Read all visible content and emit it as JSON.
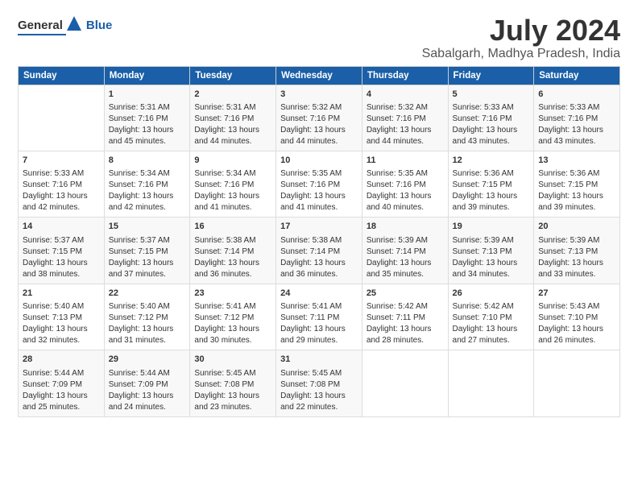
{
  "logo": {
    "general": "General",
    "blue": "Blue"
  },
  "title": "July 2024",
  "subtitle": "Sabalgarh, Madhya Pradesh, India",
  "days_header": [
    "Sunday",
    "Monday",
    "Tuesday",
    "Wednesday",
    "Thursday",
    "Friday",
    "Saturday"
  ],
  "weeks": [
    [
      {
        "day": "",
        "content": ""
      },
      {
        "day": "1",
        "content": "Sunrise: 5:31 AM\nSunset: 7:16 PM\nDaylight: 13 hours\nand 45 minutes."
      },
      {
        "day": "2",
        "content": "Sunrise: 5:31 AM\nSunset: 7:16 PM\nDaylight: 13 hours\nand 44 minutes."
      },
      {
        "day": "3",
        "content": "Sunrise: 5:32 AM\nSunset: 7:16 PM\nDaylight: 13 hours\nand 44 minutes."
      },
      {
        "day": "4",
        "content": "Sunrise: 5:32 AM\nSunset: 7:16 PM\nDaylight: 13 hours\nand 44 minutes."
      },
      {
        "day": "5",
        "content": "Sunrise: 5:33 AM\nSunset: 7:16 PM\nDaylight: 13 hours\nand 43 minutes."
      },
      {
        "day": "6",
        "content": "Sunrise: 5:33 AM\nSunset: 7:16 PM\nDaylight: 13 hours\nand 43 minutes."
      }
    ],
    [
      {
        "day": "7",
        "content": "Sunrise: 5:33 AM\nSunset: 7:16 PM\nDaylight: 13 hours\nand 42 minutes."
      },
      {
        "day": "8",
        "content": "Sunrise: 5:34 AM\nSunset: 7:16 PM\nDaylight: 13 hours\nand 42 minutes."
      },
      {
        "day": "9",
        "content": "Sunrise: 5:34 AM\nSunset: 7:16 PM\nDaylight: 13 hours\nand 41 minutes."
      },
      {
        "day": "10",
        "content": "Sunrise: 5:35 AM\nSunset: 7:16 PM\nDaylight: 13 hours\nand 41 minutes."
      },
      {
        "day": "11",
        "content": "Sunrise: 5:35 AM\nSunset: 7:16 PM\nDaylight: 13 hours\nand 40 minutes."
      },
      {
        "day": "12",
        "content": "Sunrise: 5:36 AM\nSunset: 7:15 PM\nDaylight: 13 hours\nand 39 minutes."
      },
      {
        "day": "13",
        "content": "Sunrise: 5:36 AM\nSunset: 7:15 PM\nDaylight: 13 hours\nand 39 minutes."
      }
    ],
    [
      {
        "day": "14",
        "content": "Sunrise: 5:37 AM\nSunset: 7:15 PM\nDaylight: 13 hours\nand 38 minutes."
      },
      {
        "day": "15",
        "content": "Sunrise: 5:37 AM\nSunset: 7:15 PM\nDaylight: 13 hours\nand 37 minutes."
      },
      {
        "day": "16",
        "content": "Sunrise: 5:38 AM\nSunset: 7:14 PM\nDaylight: 13 hours\nand 36 minutes."
      },
      {
        "day": "17",
        "content": "Sunrise: 5:38 AM\nSunset: 7:14 PM\nDaylight: 13 hours\nand 36 minutes."
      },
      {
        "day": "18",
        "content": "Sunrise: 5:39 AM\nSunset: 7:14 PM\nDaylight: 13 hours\nand 35 minutes."
      },
      {
        "day": "19",
        "content": "Sunrise: 5:39 AM\nSunset: 7:13 PM\nDaylight: 13 hours\nand 34 minutes."
      },
      {
        "day": "20",
        "content": "Sunrise: 5:39 AM\nSunset: 7:13 PM\nDaylight: 13 hours\nand 33 minutes."
      }
    ],
    [
      {
        "day": "21",
        "content": "Sunrise: 5:40 AM\nSunset: 7:13 PM\nDaylight: 13 hours\nand 32 minutes."
      },
      {
        "day": "22",
        "content": "Sunrise: 5:40 AM\nSunset: 7:12 PM\nDaylight: 13 hours\nand 31 minutes."
      },
      {
        "day": "23",
        "content": "Sunrise: 5:41 AM\nSunset: 7:12 PM\nDaylight: 13 hours\nand 30 minutes."
      },
      {
        "day": "24",
        "content": "Sunrise: 5:41 AM\nSunset: 7:11 PM\nDaylight: 13 hours\nand 29 minutes."
      },
      {
        "day": "25",
        "content": "Sunrise: 5:42 AM\nSunset: 7:11 PM\nDaylight: 13 hours\nand 28 minutes."
      },
      {
        "day": "26",
        "content": "Sunrise: 5:42 AM\nSunset: 7:10 PM\nDaylight: 13 hours\nand 27 minutes."
      },
      {
        "day": "27",
        "content": "Sunrise: 5:43 AM\nSunset: 7:10 PM\nDaylight: 13 hours\nand 26 minutes."
      }
    ],
    [
      {
        "day": "28",
        "content": "Sunrise: 5:44 AM\nSunset: 7:09 PM\nDaylight: 13 hours\nand 25 minutes."
      },
      {
        "day": "29",
        "content": "Sunrise: 5:44 AM\nSunset: 7:09 PM\nDaylight: 13 hours\nand 24 minutes."
      },
      {
        "day": "30",
        "content": "Sunrise: 5:45 AM\nSunset: 7:08 PM\nDaylight: 13 hours\nand 23 minutes."
      },
      {
        "day": "31",
        "content": "Sunrise: 5:45 AM\nSunset: 7:08 PM\nDaylight: 13 hours\nand 22 minutes."
      },
      {
        "day": "",
        "content": ""
      },
      {
        "day": "",
        "content": ""
      },
      {
        "day": "",
        "content": ""
      }
    ]
  ]
}
